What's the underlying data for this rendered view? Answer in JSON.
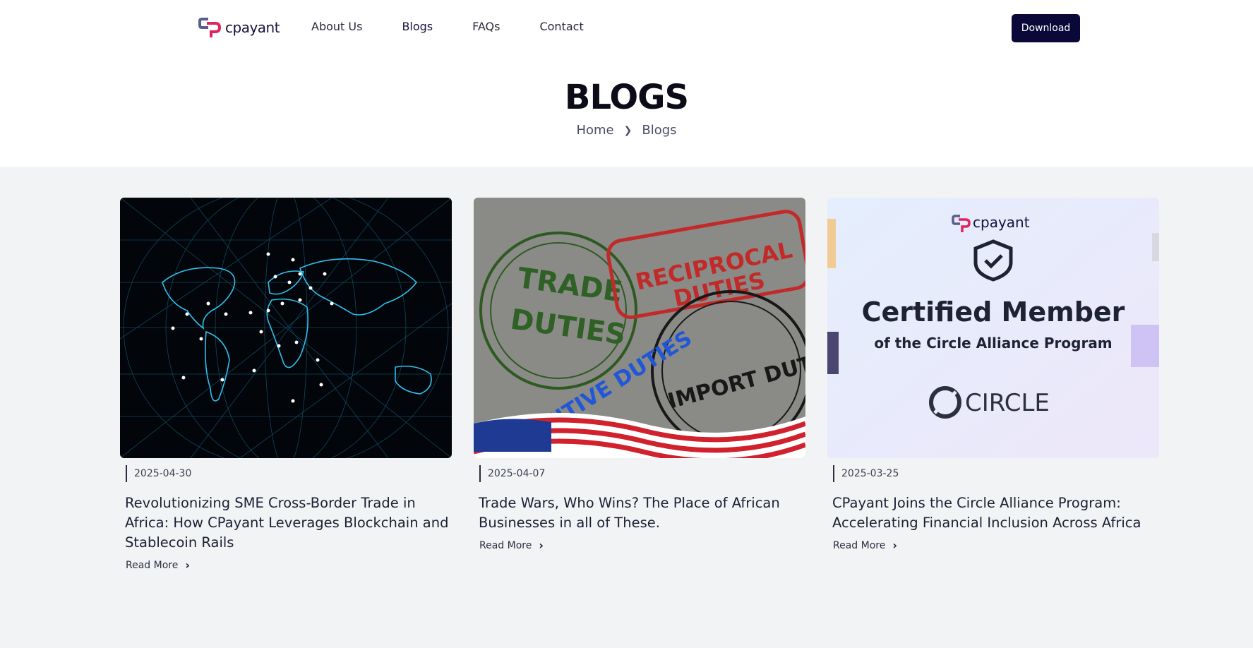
{
  "brand": {
    "name": "cpayant",
    "accent": "#e0245e",
    "dark": "#14123d"
  },
  "nav": {
    "links": [
      "About Us",
      "Blogs",
      "FAQs",
      "Contact"
    ],
    "download_label": "Download"
  },
  "hero": {
    "title": "BLOGS",
    "breadcrumb": [
      "Home",
      "Blogs"
    ]
  },
  "posts": [
    {
      "date": "2025-04-30",
      "title": "Revolutionizing SME Cross-Border Trade in Africa: How CPayant Leverages Blockchain and Stablecoin Rails",
      "read_more": "Read More",
      "image": "world-network-map"
    },
    {
      "date": "2025-04-07",
      "title": "Trade Wars, Who Wins? The Place of African Businesses in all of These.",
      "read_more": "Read More",
      "image": "duty-stamps",
      "image_text": [
        "TRADE",
        "DUTIES",
        "RECIPROCAL",
        "DUTIES",
        "PUNITIVE DUTIES",
        "IMPORT DUTIES"
      ]
    },
    {
      "date": "2025-03-25",
      "title": "CPayant Joins the Circle Alliance Program: Accelerating Financial Inclusion Across Africa",
      "read_more": "Read More",
      "image": "certified-member",
      "image_text": {
        "logo": "cpayant",
        "headline": "Certified Member",
        "subline": "of the Circle Alliance Program",
        "partner": "CIRCLE"
      }
    }
  ]
}
